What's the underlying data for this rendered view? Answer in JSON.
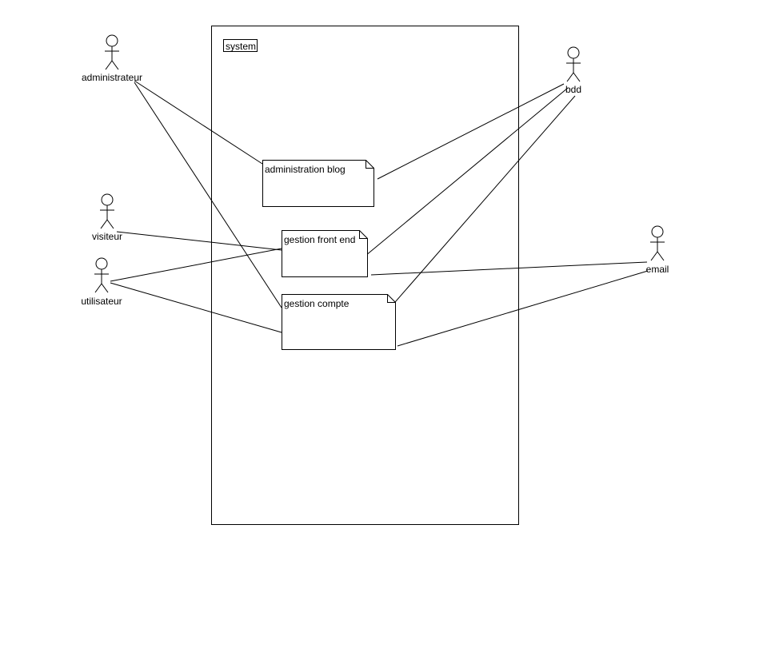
{
  "system": {
    "label": "system"
  },
  "actors": {
    "administrateur": "administrateur",
    "visiteur": "visiteur",
    "utilisateur": "utilisateur",
    "bdd": "bdd",
    "email": "email"
  },
  "use_cases": {
    "administration_blog": "administration blog",
    "gestion_front_end": "gestion front end",
    "gestion_compte": "gestion compte"
  },
  "associations": [
    {
      "from": "administrateur",
      "to": "administration blog"
    },
    {
      "from": "administrateur",
      "to": "gestion compte"
    },
    {
      "from": "visiteur",
      "to": "gestion front end"
    },
    {
      "from": "utilisateur",
      "to": "gestion front end"
    },
    {
      "from": "utilisateur",
      "to": "gestion compte"
    },
    {
      "from": "bdd",
      "to": "administration blog"
    },
    {
      "from": "bdd",
      "to": "gestion front end"
    },
    {
      "from": "bdd",
      "to": "gestion compte"
    },
    {
      "from": "email",
      "to": "gestion front end"
    },
    {
      "from": "email",
      "to": "gestion compte"
    }
  ],
  "colors": {
    "stroke": "#000000",
    "background": "#ffffff"
  }
}
